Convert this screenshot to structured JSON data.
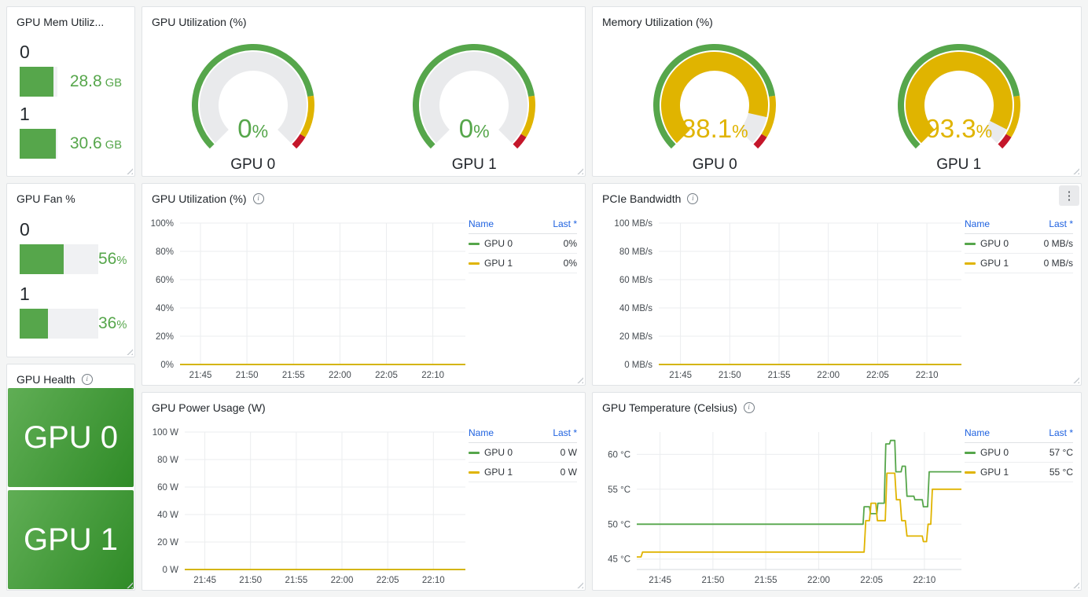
{
  "colors": {
    "green": "#56a64b",
    "yellow": "#e0b400",
    "red": "#c4162a",
    "link_blue": "#1f62e0",
    "grid": "#ebedef",
    "gauge_track": "#e9eaec"
  },
  "gauge_thresholds": [
    {
      "to": 80,
      "color": "green"
    },
    {
      "to": 95,
      "color": "yellow"
    },
    {
      "to": 100,
      "color": "red"
    }
  ],
  "panels": {
    "mem": {
      "title": "GPU Mem Utiliz...",
      "items": [
        {
          "label": "0",
          "value": "28.8",
          "unit": " GB",
          "fill_pct": 90
        },
        {
          "label": "1",
          "value": "30.6",
          "unit": " GB",
          "fill_pct": 96
        }
      ]
    },
    "util_gauge": {
      "title": "GPU Utilization (%)",
      "gauges": [
        {
          "label": "GPU 0",
          "value": "0",
          "unit": "%",
          "pct": 0,
          "color": "green"
        },
        {
          "label": "GPU 1",
          "value": "0",
          "unit": "%",
          "pct": 0,
          "color": "green"
        }
      ]
    },
    "mem_gauge": {
      "title": "Memory Utilization (%)",
      "gauges": [
        {
          "label": "GPU 0",
          "value": "88.1",
          "unit": "%",
          "pct": 88.1,
          "color": "yellow"
        },
        {
          "label": "GPU 1",
          "value": "93.3",
          "unit": "%",
          "pct": 93.3,
          "color": "yellow"
        }
      ]
    },
    "fan": {
      "title": "GPU Fan %",
      "items": [
        {
          "label": "0",
          "value": "56",
          "unit": "%",
          "fill_pct": 56
        },
        {
          "label": "1",
          "value": "36",
          "unit": "%",
          "fill_pct": 36
        }
      ]
    },
    "health": {
      "title": "GPU Health",
      "tiles": [
        {
          "label": "GPU 0"
        },
        {
          "label": "GPU 1"
        }
      ]
    },
    "util_ts": {
      "title": "GPU Utilization (%)",
      "legend": {
        "name_h": "Name",
        "last_h": "Last *",
        "rows": [
          {
            "name": "GPU 0",
            "value": "0%",
            "color": "green"
          },
          {
            "name": "GPU 1",
            "value": "0%",
            "color": "yellow"
          }
        ]
      }
    },
    "pcie": {
      "title": "PCIe Bandwidth",
      "menu_icon": "⋮",
      "legend": {
        "name_h": "Name",
        "last_h": "Last *",
        "rows": [
          {
            "name": "GPU 0",
            "value": "0 MB/s",
            "color": "green"
          },
          {
            "name": "GPU 1",
            "value": "0 MB/s",
            "color": "yellow"
          }
        ]
      }
    },
    "power": {
      "title": "GPU Power Usage (W)",
      "legend": {
        "name_h": "Name",
        "last_h": "Last *",
        "rows": [
          {
            "name": "GPU 0",
            "value": "0 W",
            "color": "green"
          },
          {
            "name": "GPU 1",
            "value": "0 W",
            "color": "yellow"
          }
        ]
      }
    },
    "temp": {
      "title": "GPU Temperature (Celsius)",
      "legend": {
        "name_h": "Name",
        "last_h": "Last *",
        "rows": [
          {
            "name": "GPU 0",
            "value": "57 °C",
            "color": "green"
          },
          {
            "name": "GPU 1",
            "value": "55 °C",
            "color": "yellow"
          }
        ]
      }
    }
  },
  "chart_data": [
    {
      "id": "util",
      "type": "line",
      "title": "GPU Utilization (%)",
      "ylim": [
        0,
        100
      ],
      "y_ticks": [
        {
          "v": 0,
          "l": "0%"
        },
        {
          "v": 20,
          "l": "20%"
        },
        {
          "v": 40,
          "l": "40%"
        },
        {
          "v": 60,
          "l": "60%"
        },
        {
          "v": 80,
          "l": "80%"
        },
        {
          "v": 100,
          "l": "100%"
        }
      ],
      "x_range": [
        0.8,
        31.5
      ],
      "x_ticks": [
        {
          "v": 3,
          "l": "21:45"
        },
        {
          "v": 8,
          "l": "21:50"
        },
        {
          "v": 13,
          "l": "21:55"
        },
        {
          "v": 18,
          "l": "22:00"
        },
        {
          "v": 23,
          "l": "22:05"
        },
        {
          "v": 28,
          "l": "22:10"
        }
      ],
      "series": [
        {
          "name": "GPU 0",
          "color": "green",
          "points": [
            [
              0.8,
              0
            ],
            [
              31.5,
              0
            ]
          ]
        },
        {
          "name": "GPU 1",
          "color": "yellow",
          "points": [
            [
              0.8,
              0
            ],
            [
              31.5,
              0
            ]
          ]
        }
      ],
      "layout": {
        "plot_left": 48,
        "legend_inset": 152
      }
    },
    {
      "id": "pcie",
      "type": "line",
      "title": "PCIe Bandwidth",
      "ylim": [
        0,
        100
      ],
      "y_ticks": [
        {
          "v": 0,
          "l": "0 MB/s"
        },
        {
          "v": 20,
          "l": "20 MB/s"
        },
        {
          "v": 40,
          "l": "40 MB/s"
        },
        {
          "v": 60,
          "l": "60 MB/s"
        },
        {
          "v": 80,
          "l": "80 MB/s"
        },
        {
          "v": 100,
          "l": "100 MB/s"
        }
      ],
      "x_range": [
        0.8,
        31.5
      ],
      "x_ticks": [
        {
          "v": 3,
          "l": "21:45"
        },
        {
          "v": 8,
          "l": "21:50"
        },
        {
          "v": 13,
          "l": "21:55"
        },
        {
          "v": 18,
          "l": "22:00"
        },
        {
          "v": 23,
          "l": "22:05"
        },
        {
          "v": 28,
          "l": "22:10"
        }
      ],
      "series": [
        {
          "name": "GPU 0",
          "color": "green",
          "points": [
            [
              0.8,
              0
            ],
            [
              31.5,
              0
            ]
          ]
        },
        {
          "name": "GPU 1",
          "color": "yellow",
          "points": [
            [
              0.8,
              0
            ],
            [
              31.5,
              0
            ]
          ]
        }
      ],
      "layout": {
        "plot_left": 84,
        "legend_inset": 152
      }
    },
    {
      "id": "power",
      "type": "line",
      "title": "GPU Power Usage (W)",
      "ylim": [
        0,
        100
      ],
      "y_ticks": [
        {
          "v": 0,
          "l": "0 W"
        },
        {
          "v": 20,
          "l": "20 W"
        },
        {
          "v": 40,
          "l": "40 W"
        },
        {
          "v": 60,
          "l": "60 W"
        },
        {
          "v": 80,
          "l": "80 W"
        },
        {
          "v": 100,
          "l": "100 W"
        }
      ],
      "x_range": [
        0.8,
        31.5
      ],
      "x_ticks": [
        {
          "v": 3,
          "l": "21:45"
        },
        {
          "v": 8,
          "l": "21:50"
        },
        {
          "v": 13,
          "l": "21:55"
        },
        {
          "v": 18,
          "l": "22:00"
        },
        {
          "v": 23,
          "l": "22:05"
        },
        {
          "v": 28,
          "l": "22:10"
        }
      ],
      "series": [
        {
          "name": "GPU 0",
          "color": "green",
          "points": [
            [
              0.8,
              0
            ],
            [
              31.5,
              0
            ]
          ]
        },
        {
          "name": "GPU 1",
          "color": "yellow",
          "points": [
            [
              0.8,
              0
            ],
            [
              31.5,
              0
            ]
          ]
        }
      ],
      "layout": {
        "plot_left": 54,
        "legend_inset": 152
      }
    },
    {
      "id": "temp",
      "type": "line",
      "title": "GPU Temperature (Celsius)",
      "ylim": [
        43.5,
        63.2
      ],
      "y_ticks": [
        {
          "v": 45,
          "l": "45 °C"
        },
        {
          "v": 50,
          "l": "50 °C"
        },
        {
          "v": 55,
          "l": "55 °C"
        },
        {
          "v": 60,
          "l": "60 °C"
        }
      ],
      "x_range": [
        0.8,
        31.5
      ],
      "x_ticks": [
        {
          "v": 3,
          "l": "21:45"
        },
        {
          "v": 8,
          "l": "21:50"
        },
        {
          "v": 13,
          "l": "21:55"
        },
        {
          "v": 18,
          "l": "22:00"
        },
        {
          "v": 23,
          "l": "22:05"
        },
        {
          "v": 28,
          "l": "22:10"
        }
      ],
      "series": [
        {
          "name": "GPU 0",
          "color": "green",
          "points": [
            [
              0.8,
              50
            ],
            [
              22.2,
              50
            ],
            [
              22.3,
              52.5
            ],
            [
              22.8,
              52.5
            ],
            [
              22.9,
              51.5
            ],
            [
              23.5,
              51.5
            ],
            [
              23.6,
              53
            ],
            [
              24.2,
              53
            ],
            [
              24.35,
              61.5
            ],
            [
              24.7,
              61.5
            ],
            [
              24.8,
              62
            ],
            [
              25.2,
              62
            ],
            [
              25.3,
              57.5
            ],
            [
              25.8,
              57.5
            ],
            [
              25.9,
              58.3
            ],
            [
              26.2,
              58.3
            ],
            [
              26.35,
              54
            ],
            [
              27.0,
              54
            ],
            [
              27.1,
              53.5
            ],
            [
              27.8,
              53.5
            ],
            [
              27.9,
              52.5
            ],
            [
              28.3,
              52.5
            ],
            [
              28.45,
              57.5
            ],
            [
              31.5,
              57.5
            ]
          ]
        },
        {
          "name": "GPU 1",
          "color": "yellow",
          "points": [
            [
              0.8,
              45.3
            ],
            [
              1.2,
              45.3
            ],
            [
              1.35,
              46
            ],
            [
              22.3,
              46
            ],
            [
              22.45,
              50.5
            ],
            [
              22.8,
              50.5
            ],
            [
              22.95,
              53
            ],
            [
              23.4,
              53
            ],
            [
              23.55,
              50.5
            ],
            [
              24.3,
              50.5
            ],
            [
              24.45,
              57.3
            ],
            [
              25.2,
              57.3
            ],
            [
              25.35,
              53.5
            ],
            [
              25.7,
              53.5
            ],
            [
              25.85,
              50.5
            ],
            [
              26.2,
              50.5
            ],
            [
              26.35,
              48.3
            ],
            [
              27.8,
              48.3
            ],
            [
              27.9,
              47.5
            ],
            [
              28.2,
              47.5
            ],
            [
              28.35,
              50
            ],
            [
              28.6,
              50
            ],
            [
              28.75,
              55
            ],
            [
              31.5,
              55
            ]
          ]
        }
      ],
      "layout": {
        "plot_left": 56,
        "legend_inset": 152
      }
    }
  ]
}
